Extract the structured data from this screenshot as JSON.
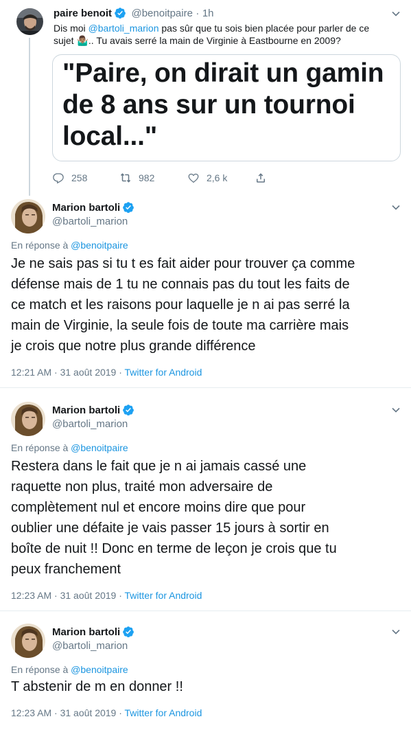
{
  "top_tweet": {
    "display_name": "paire benoit",
    "handle": "@benoitpaire",
    "separator": "·",
    "time": "1h",
    "text_prefix": "Dis moi ",
    "mention": "@bartoli_marion",
    "text_line1_rest": " pas sûr que tu sois bien placée pour parler de ce",
    "text_line2_a": "sujet ",
    "emoji": "🤷🏽‍♂️",
    "text_line2_b": ".. Tu avais serré la main de Virginie à Eastbourne en 2009?",
    "card_lines": [
      "\"Paire, on dirait un gamin",
      "de 8 ans sur un tournoi",
      "local...\""
    ],
    "card_partial_glyph": "\"",
    "actions": {
      "replies": "258",
      "retweets": "982",
      "likes": "2,6 k"
    }
  },
  "replies": [
    {
      "display_name": "Marion bartoli",
      "handle": "@bartoli_marion",
      "reply_label": "En réponse à ",
      "reply_to": "@benoitpaire",
      "lines": [
        "Je ne sais pas si tu t es fait aider pour trouver ça comme",
        "défense mais de 1 tu ne connais pas du tout les faits de",
        "ce match et les raisons pour laquelle je n ai pas serré la",
        "main de Virginie, la seule fois de toute ma carrière mais",
        "je crois que notre plus grande différence"
      ],
      "time": "12:21 AM · 31 août 2019 · ",
      "source": "Twitter for Android"
    },
    {
      "display_name": "Marion bartoli",
      "handle": "@bartoli_marion",
      "reply_label": "En réponse à ",
      "reply_to": "@benoitpaire",
      "lines": [
        "Restera dans le fait que je n ai jamais cassé une",
        "raquette non plus, traité mon adversaire de",
        "complètement nul et encore moins dire que pour",
        "oublier une défaite je vais passer 15 jours à sortir en",
        "boîte de nuit !! Donc en terme de leçon je crois que tu",
        "peux franchement"
      ],
      "time": "12:23 AM · 31 août 2019 · ",
      "source": "Twitter for Android"
    },
    {
      "display_name": "Marion bartoli",
      "handle": "@bartoli_marion",
      "reply_label": "En réponse à ",
      "reply_to": "@benoitpaire",
      "lines": [
        "T abstenir de m en donner !!"
      ],
      "time": "12:23 AM · 31 août 2019 · ",
      "source": "Twitter for Android"
    }
  ],
  "colors": {
    "accent": "#1b95e0",
    "verified": "#1da1f2",
    "text": "#14171a",
    "muted": "#657786",
    "border": "#e6ecf0"
  },
  "icons": [
    "verified-badge-icon",
    "chevron-down-icon",
    "reply-icon",
    "retweet-icon",
    "like-icon",
    "share-icon"
  ]
}
